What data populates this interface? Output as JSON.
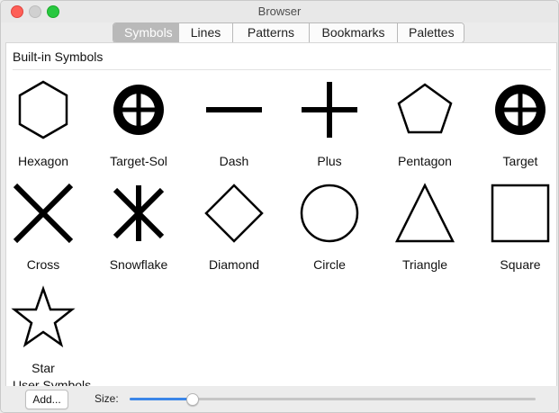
{
  "window": {
    "title": "Browser"
  },
  "tabs": [
    {
      "label": "Symbols",
      "active": true
    },
    {
      "label": "Lines",
      "active": false
    },
    {
      "label": "Patterns",
      "active": false
    },
    {
      "label": "Bookmarks",
      "active": false
    },
    {
      "label": "Palettes",
      "active": false
    }
  ],
  "sections": {
    "builtin": "Built-in Symbols",
    "user": "User Symbols"
  },
  "symbols": [
    {
      "label": "Hexagon",
      "icon": "hexagon-icon"
    },
    {
      "label": "Target-Sol",
      "icon": "target-solid-icon"
    },
    {
      "label": "Dash",
      "icon": "dash-icon"
    },
    {
      "label": "Plus",
      "icon": "plus-icon"
    },
    {
      "label": "Pentagon",
      "icon": "pentagon-icon"
    },
    {
      "label": "Target",
      "icon": "target-icon"
    },
    {
      "label": "Cross",
      "icon": "cross-icon"
    },
    {
      "label": "Snowflake",
      "icon": "snowflake-icon"
    },
    {
      "label": "Diamond",
      "icon": "diamond-icon"
    },
    {
      "label": "Circle",
      "icon": "circle-icon"
    },
    {
      "label": "Triangle",
      "icon": "triangle-icon"
    },
    {
      "label": "Square",
      "icon": "square-icon"
    },
    {
      "label": "Star",
      "icon": "star-icon"
    }
  ],
  "bottombar": {
    "add_label": "Add...",
    "size_label": "Size:",
    "size_fraction": 0.155
  },
  "colors": {
    "accent": "#3b86e8",
    "close": "#fe5f57",
    "zoom": "#28c840"
  }
}
